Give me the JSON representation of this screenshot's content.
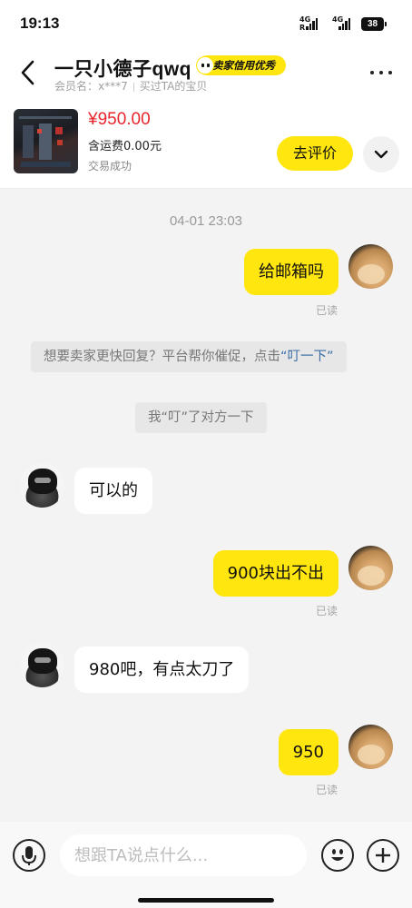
{
  "status_bar": {
    "time": "19:13",
    "signal1_label": "4G",
    "signal1_sub": "R",
    "signal2_label": "4G",
    "battery": "38"
  },
  "header": {
    "title": "一只小德子qwq",
    "badge": "卖家信用优秀",
    "member_label": "会员名：x***7",
    "bought_label": "买过TA的宝贝",
    "icons": [
      "back-arrow-icon",
      "more-dots-icon"
    ]
  },
  "product": {
    "price": "¥950.00",
    "shipping": "含运费0.00元",
    "status": "交易成功",
    "review_button": "去评价"
  },
  "chat": {
    "timestamp": "04-01 23:03",
    "messages": [
      {
        "side": "me",
        "text": "给邮箱吗",
        "read": "已读"
      },
      {
        "side": "system",
        "text_before": "想要卖家更快回复？平台帮你催促，点击",
        "link": "“叮一下”"
      },
      {
        "side": "system",
        "text": "我“叮”了对方一下"
      },
      {
        "side": "them",
        "text": "可以的"
      },
      {
        "side": "me",
        "text": "900块出不出",
        "read": "已读"
      },
      {
        "side": "them",
        "text": "980吧，有点太刀了"
      },
      {
        "side": "me",
        "text": "950",
        "read": "已读"
      }
    ]
  },
  "input_bar": {
    "placeholder": "想跟TA说点什么...",
    "icons": [
      "microphone-icon",
      "emoji-icon",
      "plus-icon"
    ]
  },
  "colors": {
    "accent": "#ffe60f",
    "price": "#e8262e",
    "link": "#3b6ea5"
  }
}
